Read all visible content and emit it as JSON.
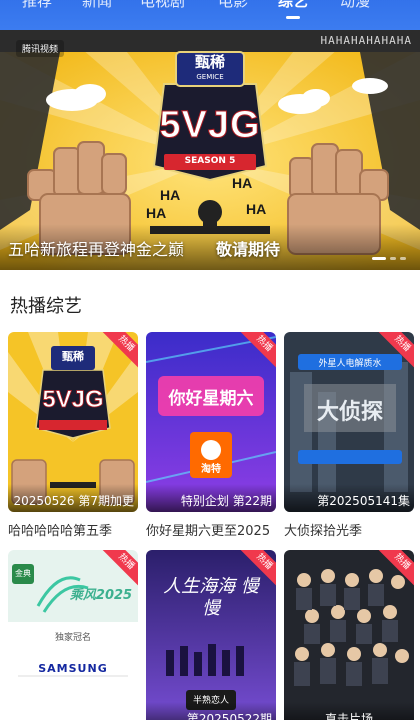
{
  "nav": {
    "tabs": [
      {
        "label": "推荐"
      },
      {
        "label": "新闻"
      },
      {
        "label": "电视剧"
      },
      {
        "label": "电影"
      },
      {
        "label": "综艺",
        "active": true
      },
      {
        "label": "动漫"
      }
    ]
  },
  "banner": {
    "brand": "腾讯视频",
    "logo_text": "甄稀",
    "logo_sub": "GEMICE",
    "show_logo": "5VJG",
    "season_text": "SEASON 5",
    "ha_text": "HAHAHAHAHAHA",
    "caption": "五哈新旅程再登神金之巅",
    "teaser": "敬请期待",
    "slide_count": 3,
    "active_slide": 0
  },
  "section": {
    "title": "热播综艺"
  },
  "cards": [
    {
      "title": "哈哈哈哈哈第五季",
      "episode": "20250526 第7期加更",
      "badge": "热播",
      "accent": "#f5c427"
    },
    {
      "title": "你好星期六更至2025",
      "episode": "特别企划 第22期",
      "badge": "热播",
      "accent": "#6a3de8"
    },
    {
      "title": "大侦探拾光季",
      "episode": "第202505141集",
      "badge": "热播",
      "accent": "#3a4a5e"
    },
    {
      "title": "",
      "episode": "",
      "badge": "热播",
      "accent": "#e8f3ef"
    },
    {
      "title": "",
      "episode": "第20250522期",
      "badge": "热播",
      "accent": "#4a2f8f"
    },
    {
      "title": "",
      "episode": "直击片场",
      "badge": "热播",
      "accent": "#2c2f36"
    }
  ],
  "posters": {
    "p1_logo": "甄稀",
    "p1_show": "5VJG",
    "p2_title": "你好星期六",
    "p2_sponsor": "淘特",
    "p3_sponsor": "外星人电解质水",
    "p3_title": "大侦探",
    "p4_brand": "金典",
    "p4_title": "乘风2025",
    "p4_sponsor_label": "独家冠名",
    "p4_samsung": "SAMSUNG",
    "p5_title": "人生海海 慢慢",
    "p5_app": "半熟恋人"
  }
}
